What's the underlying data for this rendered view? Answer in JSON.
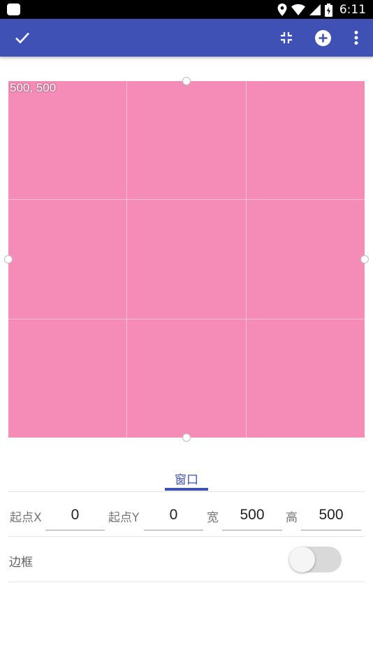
{
  "status_bar": {
    "time": "6:11",
    "icons": [
      "location-icon",
      "wifi-icon",
      "signal-icon",
      "battery-icon"
    ]
  },
  "app_bar": {
    "color": "#3f51b5",
    "actions": [
      "check-icon",
      "collapse-icon",
      "add-circle-icon",
      "more-vert-icon"
    ]
  },
  "preview": {
    "size_text": "500, 500",
    "fill_color": "#f48cb7"
  },
  "tabs": [
    {
      "label": "窗口",
      "selected": true
    }
  ],
  "window_fields": {
    "x_label": "起点X",
    "x_value": "0",
    "y_label": "起点Y",
    "y_value": "0",
    "width_label": "宽",
    "width_value": "500",
    "height_label": "高",
    "height_value": "500"
  },
  "border": {
    "label": "边框",
    "enabled": false
  }
}
